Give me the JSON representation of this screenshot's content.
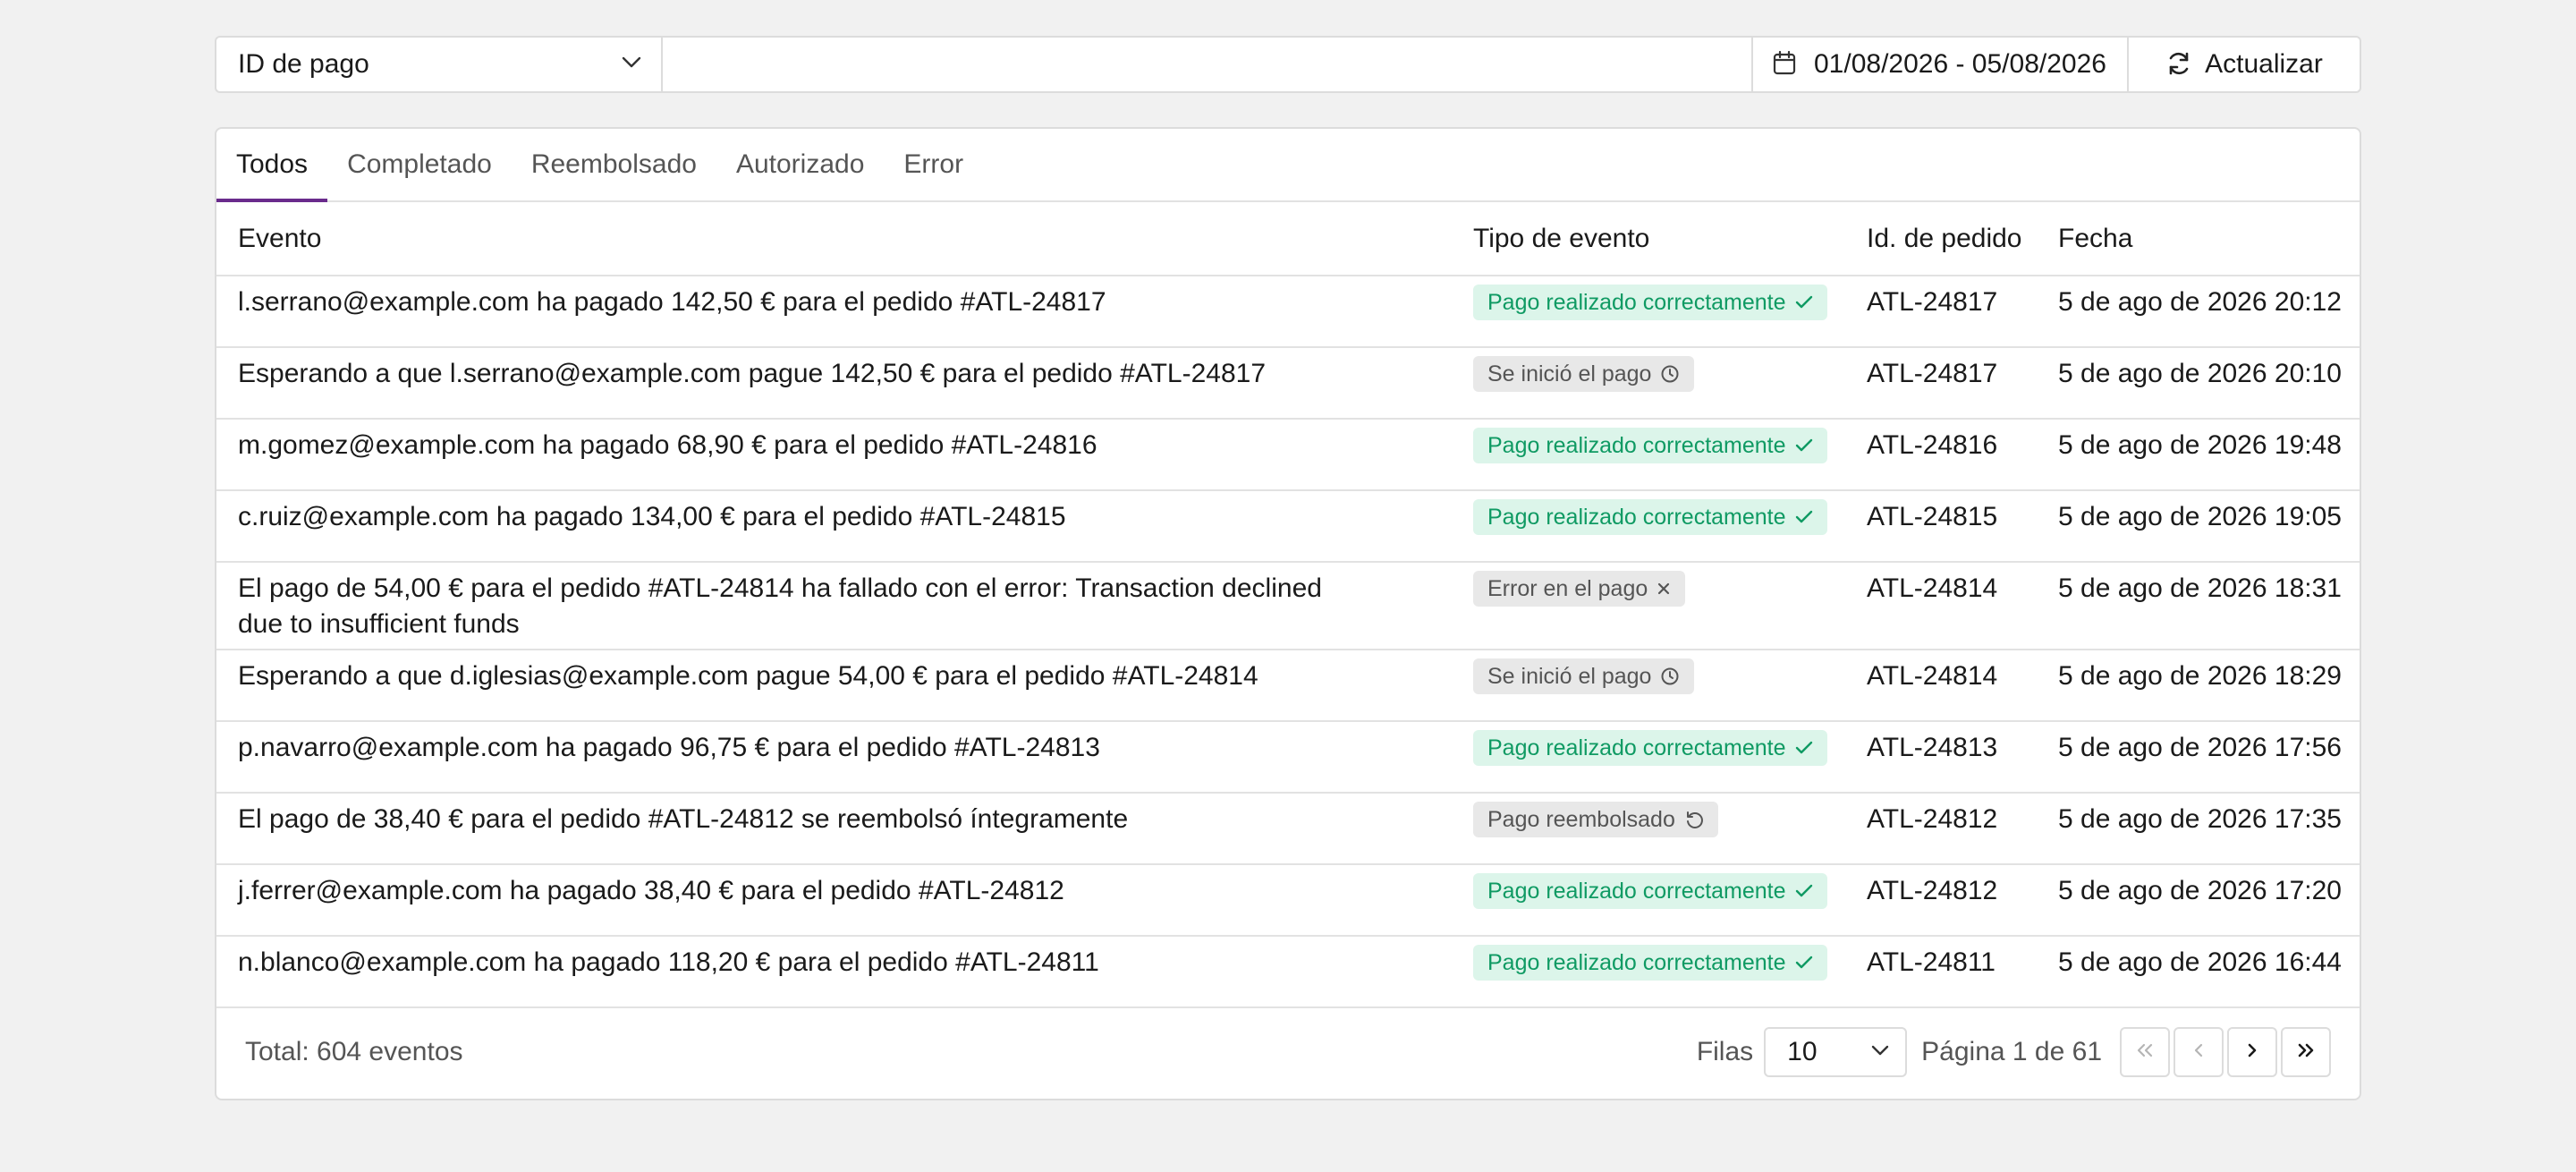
{
  "filter": {
    "field_label": "ID de pago",
    "search_placeholder": "",
    "date_range": "01/08/2026 - 05/08/2026",
    "refresh_label": "Actualizar"
  },
  "tabs": [
    {
      "label": "Todos",
      "active": true
    },
    {
      "label": "Completado",
      "active": false
    },
    {
      "label": "Reembolsado",
      "active": false
    },
    {
      "label": "Autorizado",
      "active": false
    },
    {
      "label": "Error",
      "active": false
    }
  ],
  "table": {
    "headers": [
      "Evento",
      "Tipo de evento",
      "Id. de pedido",
      "Fecha"
    ],
    "rows": [
      {
        "event": "l.serrano@example.com ha pagado 142,50 € para el pedido #ATL-24817",
        "type": "Pago realizado correctamente",
        "status": "success",
        "icon": "check-icon",
        "order": "ATL-24817",
        "date": "5 de ago de 2026 20:12"
      },
      {
        "event": "Esperando a que l.serrano@example.com pague 142,50 € para el pedido #ATL-24817",
        "type": "Se inició el pago",
        "status": "neutral",
        "icon": "clock-icon",
        "order": "ATL-24817",
        "date": "5 de ago de 2026 20:10"
      },
      {
        "event": "m.gomez@example.com ha pagado 68,90 € para el pedido #ATL-24816",
        "type": "Pago realizado correctamente",
        "status": "success",
        "icon": "check-icon",
        "order": "ATL-24816",
        "date": "5 de ago de 2026 19:48"
      },
      {
        "event": "c.ruiz@example.com ha pagado 134,00 € para el pedido #ATL-24815",
        "type": "Pago realizado correctamente",
        "status": "success",
        "icon": "check-icon",
        "order": "ATL-24815",
        "date": "5 de ago de 2026 19:05"
      },
      {
        "event": "El pago de 54,00 € para el pedido #ATL-24814 ha fallado con el error: Transaction declined due to insufficient funds",
        "type": "Error en el pago",
        "status": "neutral",
        "icon": "x-icon",
        "order": "ATL-24814",
        "date": "5 de ago de 2026 18:31"
      },
      {
        "event": "Esperando a que d.iglesias@example.com pague 54,00 € para el pedido #ATL-24814",
        "type": "Se inició el pago",
        "status": "neutral",
        "icon": "clock-icon",
        "order": "ATL-24814",
        "date": "5 de ago de 2026 18:29"
      },
      {
        "event": "p.navarro@example.com ha pagado 96,75 € para el pedido #ATL-24813",
        "type": "Pago realizado correctamente",
        "status": "success",
        "icon": "check-icon",
        "order": "ATL-24813",
        "date": "5 de ago de 2026 17:56"
      },
      {
        "event": "El pago de 38,40 € para el pedido #ATL-24812 se reembolsó íntegramente",
        "type": "Pago reembolsado",
        "status": "neutral",
        "icon": "refund-icon",
        "order": "ATL-24812",
        "date": "5 de ago de 2026 17:35"
      },
      {
        "event": "j.ferrer@example.com ha pagado 38,40 € para el pedido #ATL-24812",
        "type": "Pago realizado correctamente",
        "status": "success",
        "icon": "check-icon",
        "order": "ATL-24812",
        "date": "5 de ago de 2026 17:20"
      },
      {
        "event": "n.blanco@example.com ha pagado 118,20 € para el pedido #ATL-24811",
        "type": "Pago realizado correctamente",
        "status": "success",
        "icon": "check-icon",
        "order": "ATL-24811",
        "date": "5 de ago de 2026 16:44"
      }
    ]
  },
  "footer": {
    "total": "Total: 604 eventos",
    "rows_label": "Filas",
    "rows_value": "10",
    "page_info": "Página 1 de 61"
  },
  "colors": {
    "accent": "#6a2b8c",
    "success_bg": "#dcf5ea",
    "success_text": "#0f9a63",
    "neutral_bg": "#e8e8e8",
    "neutral_text": "#555555"
  }
}
